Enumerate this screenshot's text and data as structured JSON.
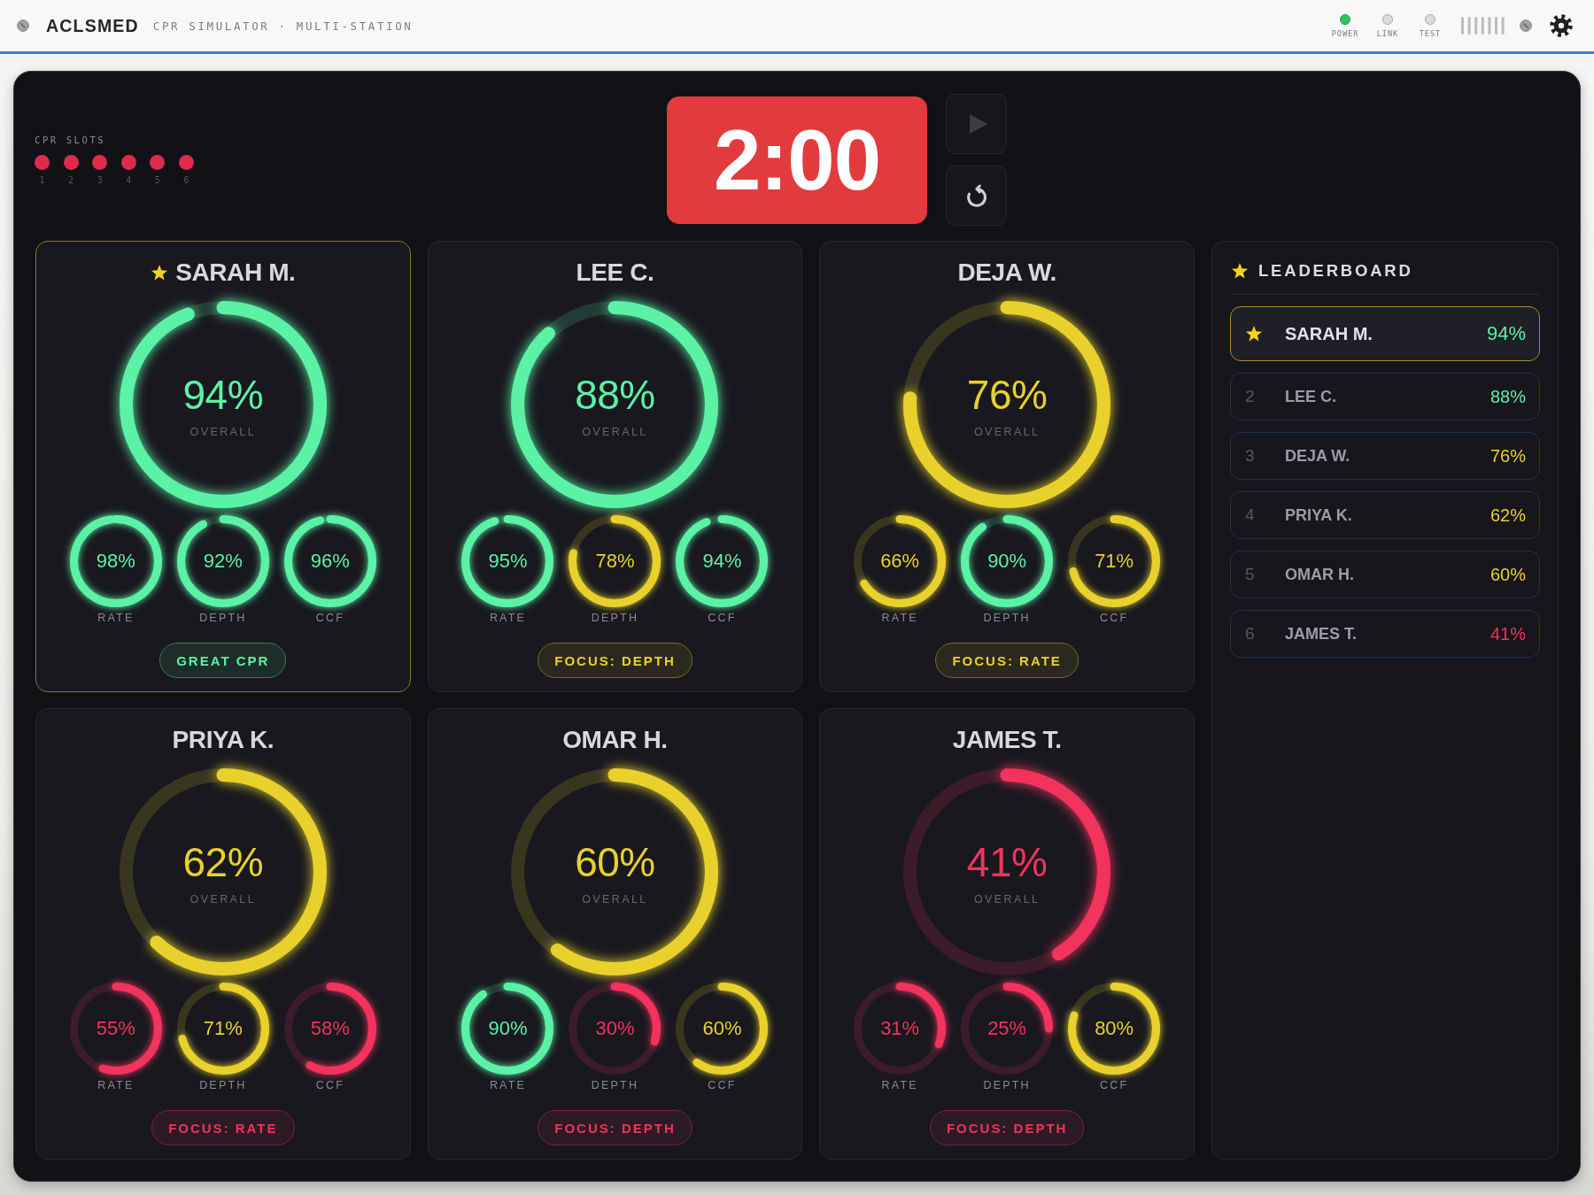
{
  "header": {
    "brand": "ACLSMED",
    "subtitle": "CPR SIMULATOR · MULTI-STATION",
    "indicators": [
      {
        "label": "POWER",
        "on": true
      },
      {
        "label": "LINK",
        "on": false
      },
      {
        "label": "TEST",
        "on": false
      }
    ]
  },
  "slots": {
    "label": "CPR SLOTS",
    "items": [
      {
        "number": "1",
        "active": true
      },
      {
        "number": "2",
        "active": true
      },
      {
        "number": "3",
        "active": true
      },
      {
        "number": "4",
        "active": true
      },
      {
        "number": "5",
        "active": true
      },
      {
        "number": "6",
        "active": true
      }
    ]
  },
  "timer": {
    "value": "2:00",
    "play": {
      "disabled": true
    }
  },
  "stations": [
    {
      "name": "SARAH M.",
      "leader": true,
      "overall": {
        "value": "94%",
        "label": "OVERALL",
        "level": 0.94,
        "color": "#5cf2a6"
      },
      "metrics": [
        {
          "label": "RATE",
          "value": "98%",
          "level": 0.98,
          "color": "#5cf2a6"
        },
        {
          "label": "DEPTH",
          "value": "92%",
          "level": 0.92,
          "color": "#5cf2a6"
        },
        {
          "label": "CCF",
          "value": "96%",
          "level": 0.96,
          "color": "#5cf2a6"
        }
      ],
      "badge": {
        "text": "GREAT CPR",
        "color": "#5cf2a6"
      }
    },
    {
      "name": "LEE C.",
      "leader": false,
      "overall": {
        "value": "88%",
        "label": "OVERALL",
        "level": 0.88,
        "color": "#5cf2a6"
      },
      "metrics": [
        {
          "label": "RATE",
          "value": "95%",
          "level": 0.95,
          "color": "#5cf2a6"
        },
        {
          "label": "DEPTH",
          "value": "78%",
          "level": 0.78,
          "color": "#e8d12c"
        },
        {
          "label": "CCF",
          "value": "94%",
          "level": 0.94,
          "color": "#5cf2a6"
        }
      ],
      "badge": {
        "text": "FOCUS: DEPTH",
        "color": "#e8d12c"
      }
    },
    {
      "name": "DEJA W.",
      "leader": false,
      "overall": {
        "value": "76%",
        "label": "OVERALL",
        "level": 0.76,
        "color": "#e8d12c"
      },
      "metrics": [
        {
          "label": "RATE",
          "value": "66%",
          "level": 0.66,
          "color": "#e8d12c"
        },
        {
          "label": "DEPTH",
          "value": "90%",
          "level": 0.9,
          "color": "#5cf2a6"
        },
        {
          "label": "CCF",
          "value": "71%",
          "level": 0.71,
          "color": "#e8d12c"
        }
      ],
      "badge": {
        "text": "FOCUS: RATE",
        "color": "#e8d12c"
      }
    },
    {
      "name": "PRIYA K.",
      "leader": false,
      "overall": {
        "value": "62%",
        "label": "OVERALL",
        "level": 0.62,
        "color": "#e8d12c"
      },
      "metrics": [
        {
          "label": "RATE",
          "value": "55%",
          "level": 0.55,
          "color": "#f2335d"
        },
        {
          "label": "DEPTH",
          "value": "71%",
          "level": 0.71,
          "color": "#e8d12c"
        },
        {
          "label": "CCF",
          "value": "58%",
          "level": 0.58,
          "color": "#f2335d"
        }
      ],
      "badge": {
        "text": "FOCUS: RATE",
        "color": "#f2335d"
      }
    },
    {
      "name": "OMAR H.",
      "leader": false,
      "overall": {
        "value": "60%",
        "label": "OVERALL",
        "level": 0.6,
        "color": "#e8d12c"
      },
      "metrics": [
        {
          "label": "RATE",
          "value": "90%",
          "level": 0.9,
          "color": "#5cf2a6"
        },
        {
          "label": "DEPTH",
          "value": "30%",
          "level": 0.3,
          "color": "#f2335d"
        },
        {
          "label": "CCF",
          "value": "60%",
          "level": 0.6,
          "color": "#e8d12c"
        }
      ],
      "badge": {
        "text": "FOCUS: DEPTH",
        "color": "#f2335d"
      }
    },
    {
      "name": "JAMES T.",
      "leader": false,
      "overall": {
        "value": "41%",
        "label": "OVERALL",
        "level": 0.41,
        "color": "#f2335d"
      },
      "metrics": [
        {
          "label": "RATE",
          "value": "31%",
          "level": 0.31,
          "color": "#f2335d"
        },
        {
          "label": "DEPTH",
          "value": "25%",
          "level": 0.25,
          "color": "#f2335d"
        },
        {
          "label": "CCF",
          "value": "80%",
          "level": 0.8,
          "color": "#e8d12c"
        }
      ],
      "badge": {
        "text": "FOCUS: DEPTH",
        "color": "#f2335d"
      }
    }
  ],
  "leaderboard": {
    "title": "LEADERBOARD",
    "rows": [
      {
        "leader": true,
        "name": "SARAH M.",
        "score": "94%",
        "color": "#5cf2a6"
      },
      {
        "leader": false,
        "rank": "2",
        "name": "LEE C.",
        "score": "88%",
        "color": "#5cf2a6"
      },
      {
        "leader": false,
        "rank": "3",
        "name": "DEJA W.",
        "score": "76%",
        "color": "#e8d12c"
      },
      {
        "leader": false,
        "rank": "4",
        "name": "PRIYA K.",
        "score": "62%",
        "color": "#e8d12c"
      },
      {
        "leader": false,
        "rank": "5",
        "name": "OMAR H.",
        "score": "60%",
        "color": "#e8d12c"
      },
      {
        "leader": false,
        "rank": "6",
        "name": "JAMES T.",
        "score": "41%",
        "color": "#f2335d"
      }
    ]
  }
}
